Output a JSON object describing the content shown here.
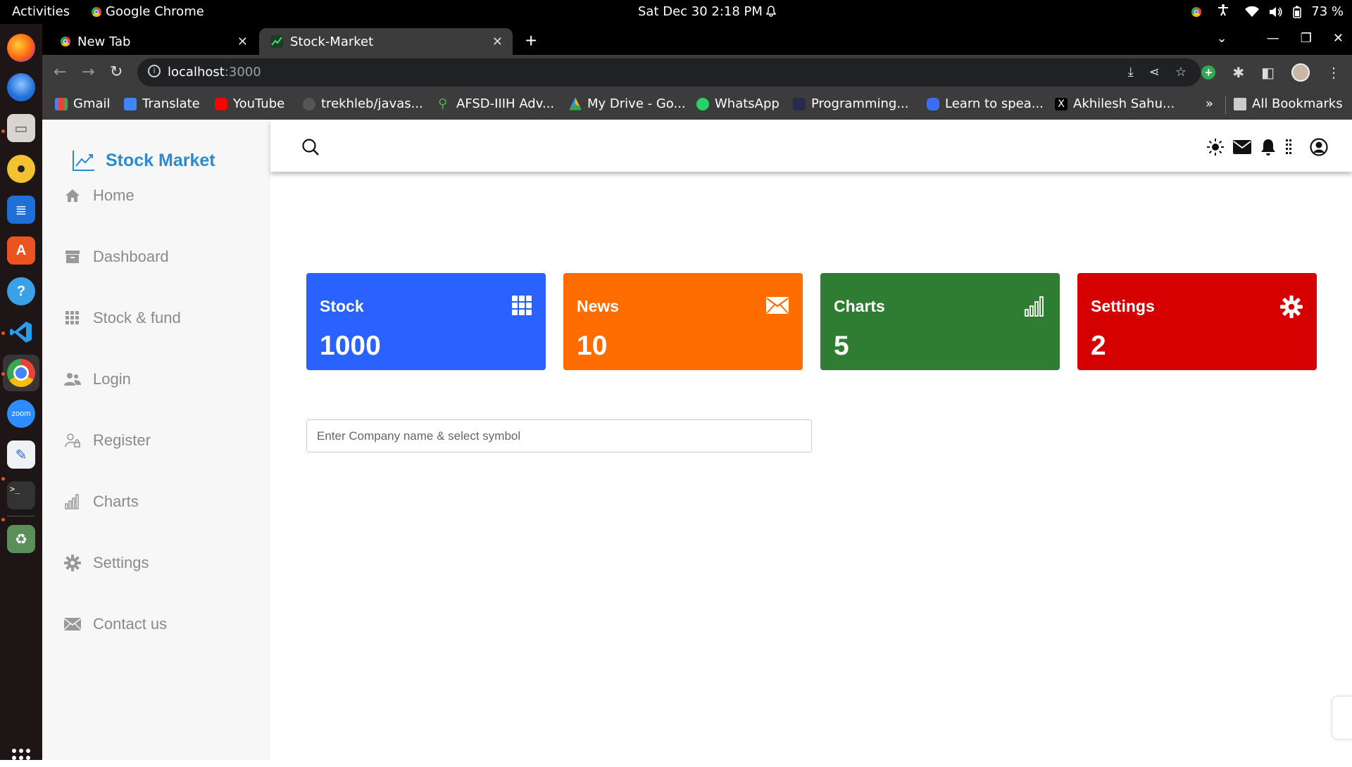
{
  "system_bar": {
    "activities": "Activities",
    "app_name": "Google Chrome",
    "clock": "Sat Dec 30  2:18 PM",
    "battery": "73 %"
  },
  "dock": {
    "apps": [
      "firefox-icon",
      "thunderbird-icon",
      "files-icon",
      "rhythmbox-icon",
      "writer-icon",
      "app-center-icon",
      "help-icon",
      "vscode-icon",
      "chrome-icon",
      "zoom-icon",
      "text-editor-icon",
      "terminal-icon",
      "trash-icon"
    ],
    "zoom_label": "zoom"
  },
  "browser": {
    "tabs": [
      {
        "title": "New Tab"
      },
      {
        "title": "Stock-Market"
      }
    ],
    "url_host": "localhost",
    "url_port": ":3000",
    "bookmarks": [
      "Gmail",
      "Translate",
      "YouTube",
      "trekhleb/javas...",
      "AFSD-IIIH Adv...",
      "My Drive - Go...",
      "WhatsApp",
      "Programming...",
      "Learn to spea...",
      "Akhilesh Sahu..."
    ],
    "more_bookmarks": "»",
    "all_bookmarks": "All Bookmarks"
  },
  "app": {
    "brand": "Stock Market",
    "nav": [
      {
        "label": "Home",
        "icon": "home-icon"
      },
      {
        "label": "Dashboard",
        "icon": "archive-icon"
      },
      {
        "label": "Stock & fund",
        "icon": "grid-icon"
      },
      {
        "label": "Login",
        "icon": "users-icon"
      },
      {
        "label": "Register",
        "icon": "user-lock-icon"
      },
      {
        "label": "Charts",
        "icon": "bar-chart-icon"
      },
      {
        "label": "Settings",
        "icon": "gear-icon"
      },
      {
        "label": "Contact us",
        "icon": "envelope-icon"
      }
    ],
    "header_icons": [
      "sun-icon",
      "envelope-icon",
      "bell-icon",
      "more-vertical-icon",
      "user-circle-icon"
    ],
    "cards": [
      {
        "title": "Stock",
        "value": "1000",
        "color": "#2962ff",
        "icon": "grid-icon"
      },
      {
        "title": "News",
        "value": "10",
        "color": "#ff6d00",
        "icon": "envelope-icon"
      },
      {
        "title": "Charts",
        "value": "5",
        "color": "#2e7d32",
        "icon": "bar-chart-icon"
      },
      {
        "title": "Settings",
        "value": "2",
        "color": "#d50000",
        "icon": "gear-icon"
      }
    ],
    "company_search": {
      "placeholder": "Enter Company name & select symbol",
      "value": ""
    },
    "colors": {
      "brand": "#2a8bd0",
      "sidebar_bg": "#f7f7f7"
    }
  }
}
